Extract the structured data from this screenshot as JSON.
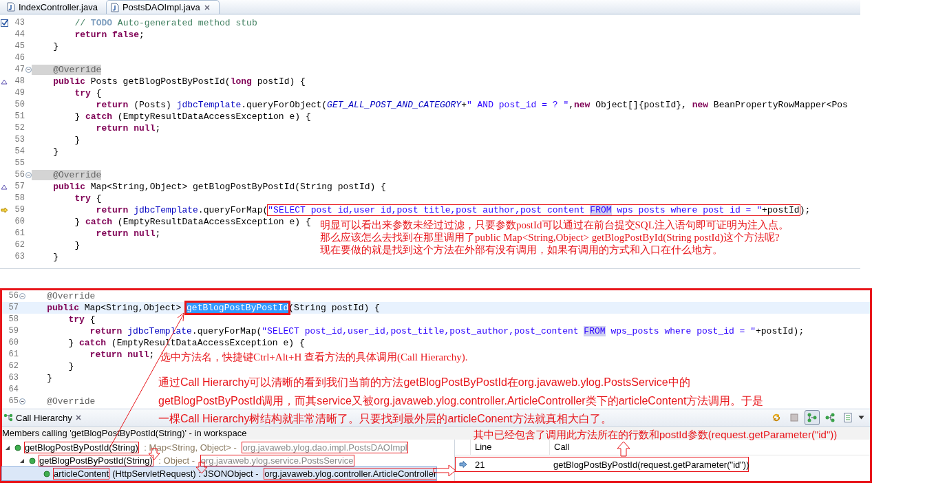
{
  "editor": {
    "tabs": [
      {
        "label": "IndexController.java",
        "selected": false
      },
      {
        "label": "PostsDAOImpl.java",
        "selected": true
      }
    ],
    "lines": [
      {
        "number": "43",
        "kind": "task",
        "tokens": [
          {
            "kind": "c",
            "text": "        // "
          },
          {
            "kind": "todo",
            "text": "TODO"
          },
          {
            "kind": "c",
            "text": " Auto-generated method stub"
          }
        ]
      },
      {
        "number": "44",
        "tokens": [
          {
            "kind": "k",
            "text": "        return"
          },
          {
            "kind": "k",
            "text": " false"
          },
          {
            "kind": "t",
            "text": ";"
          }
        ]
      },
      {
        "number": "45",
        "tokens": [
          {
            "kind": "t",
            "text": "    }"
          }
        ]
      },
      {
        "number": "46"
      },
      {
        "number": "47",
        "fold": true,
        "tokens": [
          {
            "kind": "ah",
            "text": "    @Override"
          }
        ]
      },
      {
        "number": "48",
        "kind": "override",
        "tokens": [
          {
            "kind": "k",
            "text": "    public"
          },
          {
            "kind": "t",
            "text": " Posts getBlogPostByPostId("
          },
          {
            "kind": "k",
            "text": "long"
          },
          {
            "kind": "t",
            "text": " postId) {"
          }
        ]
      },
      {
        "number": "49",
        "tokens": [
          {
            "kind": "k",
            "text": "        try"
          },
          {
            "kind": "t",
            "text": " {"
          }
        ]
      },
      {
        "number": "50",
        "tokens": [
          {
            "kind": "k",
            "text": "            return"
          },
          {
            "kind": "t",
            "text": " (Posts) "
          },
          {
            "kind": "f",
            "text": "jdbcTemplate"
          },
          {
            "kind": "t",
            "text": ".queryForObject("
          },
          {
            "kind": "sf",
            "text": "GET_ALL_POST_AND_CATEGORY"
          },
          {
            "kind": "t",
            "text": "+"
          },
          {
            "kind": "s",
            "text": "\" AND post_id = ? \""
          },
          {
            "kind": "t",
            "text": ","
          },
          {
            "kind": "k",
            "text": "new"
          },
          {
            "kind": "t",
            "text": " Object[]{postId}, "
          },
          {
            "kind": "k",
            "text": "new"
          },
          {
            "kind": "t",
            "text": " BeanPropertyRowMapper<Pos"
          }
        ]
      },
      {
        "number": "51",
        "tokens": [
          {
            "kind": "t",
            "text": "        } "
          },
          {
            "kind": "k",
            "text": "catch"
          },
          {
            "kind": "t",
            "text": " (EmptyResultDataAccessException e) {"
          }
        ]
      },
      {
        "number": "52",
        "tokens": [
          {
            "kind": "k",
            "text": "            return"
          },
          {
            "kind": "k",
            "text": " null"
          },
          {
            "kind": "t",
            "text": ";"
          }
        ]
      },
      {
        "number": "53",
        "tokens": [
          {
            "kind": "t",
            "text": "        }"
          }
        ]
      },
      {
        "number": "54",
        "tokens": [
          {
            "kind": "t",
            "text": "    }"
          }
        ]
      },
      {
        "number": "55"
      },
      {
        "number": "56",
        "fold": true,
        "tokens": [
          {
            "kind": "ah",
            "text": "    @Override"
          }
        ]
      },
      {
        "number": "57",
        "kind": "override",
        "tokens": [
          {
            "kind": "k",
            "text": "    public"
          },
          {
            "kind": "t",
            "text": " Map<String,Object> getBlogPostByPostId(String postId) {"
          }
        ]
      },
      {
        "number": "58",
        "tokens": [
          {
            "kind": "k",
            "text": "        try"
          },
          {
            "kind": "t",
            "text": " {"
          }
        ]
      },
      {
        "number": "59",
        "kind": "debug",
        "tokens": [
          {
            "kind": "k",
            "text": "            return"
          },
          {
            "kind": "f",
            "text": " jdbcTemplate"
          },
          {
            "kind": "t",
            "text": ".queryForMap("
          },
          {
            "kind": "box",
            "tokens": [
              {
                "kind": "s",
                "text": "\"SELECT post id,user id,post title,post author,post content "
              },
              {
                "kind": "hl",
                "text": "FROM"
              },
              {
                "kind": "s",
                "text": " wps posts where post id = \""
              },
              {
                "kind": "t",
                "text": "+postId"
              }
            ]
          },
          {
            "kind": "t",
            "text": ");"
          }
        ]
      },
      {
        "number": "60",
        "tokens": [
          {
            "kind": "t",
            "text": "        } "
          },
          {
            "kind": "k",
            "text": "catch"
          },
          {
            "kind": "t",
            "text": " (EmptyResultDataAccessException e) {"
          }
        ]
      },
      {
        "number": "61",
        "tokens": [
          {
            "kind": "k",
            "text": "            return"
          },
          {
            "kind": "k",
            "text": " null"
          },
          {
            "kind": "t",
            "text": ";"
          }
        ]
      },
      {
        "number": "62",
        "tokens": [
          {
            "kind": "t",
            "text": "        }"
          }
        ]
      },
      {
        "number": "63",
        "tokens": [
          {
            "kind": "t",
            "text": "    }"
          }
        ]
      }
    ]
  },
  "notes_top": [
    "明显可以看出来参数未经过过滤，只要参数postId可以通过在前台提交SQL注入语句即可证明为注入点。",
    "那么应该怎么去找到在那里调用了public Map<String,Object> getBlogPostById(String postId)这个方法呢?",
    "现在要做的就是找到这个方法在外部有没有调用，如果有调用的方式和入口在什么地方。"
  ],
  "detail_editor": {
    "lines": [
      {
        "number": "56",
        "fold": true,
        "current": false,
        "tokens": [
          {
            "kind": "a",
            "text": "    @Override"
          }
        ]
      },
      {
        "number": "57",
        "current": true,
        "tokens": [
          {
            "kind": "k",
            "text": "    public"
          },
          {
            "kind": "t",
            "text": " Map<String,Object> "
          },
          {
            "kind": "box",
            "tokens": [
              {
                "kind": "sel",
                "text": "getBlogPostByPostId"
              }
            ]
          },
          {
            "kind": "t",
            "text": "(String postId) {"
          }
        ]
      },
      {
        "number": "58",
        "current": false,
        "tokens": [
          {
            "kind": "k",
            "text": "        try"
          },
          {
            "kind": "t",
            "text": " {"
          }
        ]
      },
      {
        "number": "59",
        "current": false,
        "tokens": [
          {
            "kind": "k",
            "text": "            return"
          },
          {
            "kind": "f",
            "text": " jdbcTemplate"
          },
          {
            "kind": "t",
            "text": ".queryForMap("
          },
          {
            "kind": "s",
            "text": "\"SELECT post_id,user_id,post_title,post_author,post_content "
          },
          {
            "kind": "hl",
            "text": "FROM"
          },
          {
            "kind": "s",
            "text": " wps_posts where post_id = \""
          },
          {
            "kind": "t",
            "text": "+postId);"
          }
        ]
      },
      {
        "number": "60",
        "current": false,
        "tokens": [
          {
            "kind": "t",
            "text": "        } "
          },
          {
            "kind": "k",
            "text": "catch"
          },
          {
            "kind": "t",
            "text": " (EmptyResultDataAccessException e) {"
          }
        ]
      },
      {
        "number": "61",
        "current": false,
        "tokens": [
          {
            "kind": "k",
            "text": "            return"
          },
          {
            "kind": "k",
            "text": " null"
          },
          {
            "kind": "t",
            "text": ";"
          }
        ]
      },
      {
        "number": "62",
        "current": false,
        "tokens": [
          {
            "kind": "t",
            "text": "        }"
          }
        ]
      },
      {
        "number": "63",
        "current": false,
        "tokens": [
          {
            "kind": "t",
            "text": "    }"
          }
        ]
      },
      {
        "number": "64",
        "current": false
      },
      {
        "number": "65",
        "fold": true,
        "current": false,
        "tokens": [
          {
            "kind": "a",
            "text": "    @Override"
          }
        ]
      }
    ]
  },
  "hierarchy": {
    "title": "Call Hierarchy",
    "toolbar": [
      {
        "kind": "refresh",
        "selected": false
      },
      {
        "kind": "stop",
        "selected": false
      },
      {
        "kind": "callers",
        "selected": true
      },
      {
        "kind": "callees",
        "selected": false
      },
      {
        "kind": "history",
        "selected": false
      }
    ],
    "caption": "Members calling 'getBlogPostByPostId(String)' - in workspace",
    "tree": [
      {
        "method": "getBlogPostByPostId(String)",
        "detail": " : Map<String, Object> - ",
        "owner": "org.javaweb.ylog.dao.impl.PostsDAOImpl",
        "expanded": true,
        "selected": false,
        "children": [
          {
            "method": "getBlogPostByPostId(String)",
            "detail": " : Object - ",
            "owner": "org.javaweb.ylog.service.PostsService",
            "expanded": true,
            "selected": false,
            "children": [
              {
                "method": "articleContent",
                "detail": "(HttpServletRequest) : JSONObject - ",
                "owner": "org.javaweb.ylog.controller.ArticleController",
                "selected": true
              }
            ]
          }
        ]
      }
    ],
    "table": {
      "columns": [
        "Line",
        "Call"
      ],
      "rows": [
        {
          "line": "21",
          "call": "getBlogPostByPostId(request.getParameter(\"id\"))"
        }
      ]
    }
  },
  "notes_bottom": {
    "shortcut": "选中方法名，快捷键Ctrl+Alt+H 查看方法的具体调用(Call Hierarchy).",
    "explanation": "通过Call Hierarchy可以清晰的看到我们当前的方法getBlogPostByPostId在org.javaweb.ylog.PostsService中的getBlogPostByPostId调用，而其service又被org.javaweb.ylog.controller.ArticleController类下的articleContent方法调用。于是一棵Call Hierarchy树结构就非常清晰了。只要找到最外层的articleConent方法就真相大白了。",
    "result": "其中已经包含了调用此方法所在的行数和postId参数(request.getParameter(\"id\"))"
  }
}
